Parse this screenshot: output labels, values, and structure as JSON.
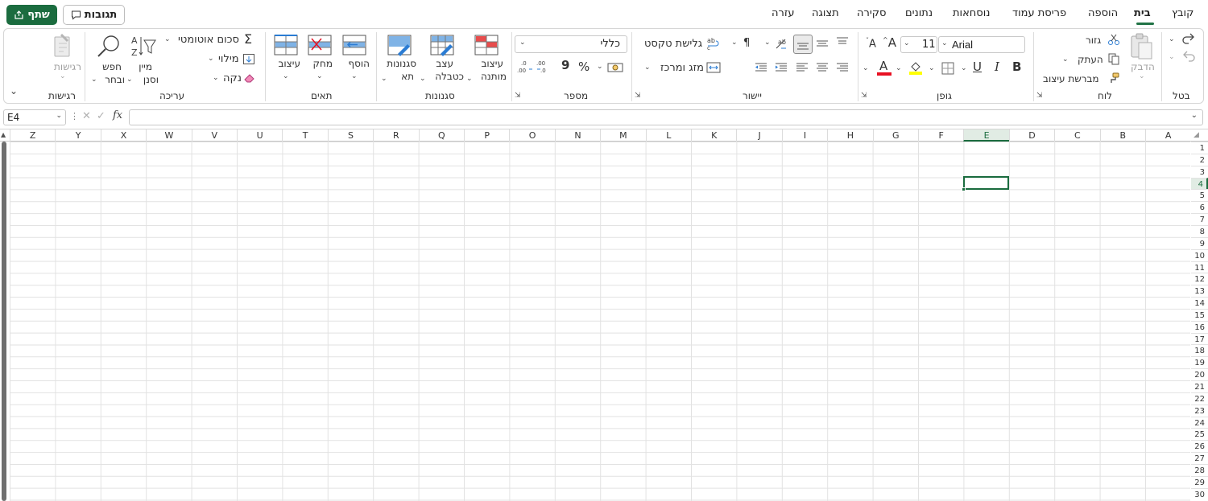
{
  "tabs": [
    {
      "key": "file",
      "label": "קובץ"
    },
    {
      "key": "home",
      "label": "בית",
      "active": true
    },
    {
      "key": "insert",
      "label": "הוספה"
    },
    {
      "key": "page_layout",
      "label": "פריסת עמוד"
    },
    {
      "key": "formulas",
      "label": "נוסחאות"
    },
    {
      "key": "data",
      "label": "נתונים"
    },
    {
      "key": "review",
      "label": "סקירה"
    },
    {
      "key": "view",
      "label": "תצוגה"
    },
    {
      "key": "help",
      "label": "עזרה"
    }
  ],
  "share_label": "שתף",
  "comments_label": "תגובות",
  "ribbon": {
    "undo_group": {
      "label": "בטל"
    },
    "clipboard": {
      "label": "לוח",
      "paste": "הדבק",
      "cut": "גזור",
      "copy": "העתק",
      "format_painter": "מברשת עיצוב"
    },
    "font": {
      "label": "גופן",
      "font_name": "Arial",
      "font_size": "11",
      "bold": "B",
      "italic": "I",
      "underline": "U"
    },
    "alignment": {
      "label": "יישור",
      "wrap_text": "גלישת טקסט",
      "merge_center": "מזג ומרכז"
    },
    "number": {
      "label": "מספר",
      "format": "כללי",
      "percent": "%",
      "comma": "9",
      "inc_decimal": ".00\n.0",
      "dec_decimal": ".00\n.0"
    },
    "styles": {
      "label": "סגנונות",
      "conditional": "עיצוב",
      "conditional2": "מותנה",
      "as_table": "עצב",
      "as_table2": "כטבלה",
      "cell_styles": "סגנונות",
      "cell_styles2": "תא"
    },
    "cells": {
      "label": "תאים",
      "insert": "הוסף",
      "delete": "מחק",
      "format": "עיצוב"
    },
    "editing": {
      "label": "עריכה",
      "autosum": "סכום אוטומטי",
      "fill": "מילוי",
      "clear": "נקה",
      "sort": "מיין",
      "sort2": "וסנן",
      "find": "חפש",
      "find2": "ובחר"
    },
    "sensitivity": {
      "label": "רגישות",
      "button": "רגישות"
    }
  },
  "name_box": "E4",
  "fx_label": "fx",
  "columns": [
    "Z",
    "Y",
    "X",
    "W",
    "V",
    "U",
    "T",
    "S",
    "R",
    "Q",
    "P",
    "O",
    "N",
    "M",
    "L",
    "K",
    "J",
    "I",
    "H",
    "G",
    "F",
    "E",
    "D",
    "C",
    "B",
    "A"
  ],
  "selected_column": "E",
  "rows": [
    "1",
    "2",
    "3",
    "4",
    "5",
    "6",
    "7",
    "8",
    "9",
    "10",
    "11",
    "12",
    "13",
    "14",
    "15",
    "16",
    "17",
    "18",
    "19",
    "20",
    "21",
    "22",
    "23",
    "24",
    "25",
    "26",
    "27",
    "28",
    "29",
    "30"
  ],
  "selected_row": "4",
  "colors": {
    "accent": "#1b6c3f",
    "font_color_bar": "#e81123",
    "highlight_bar": "#ffff00"
  }
}
